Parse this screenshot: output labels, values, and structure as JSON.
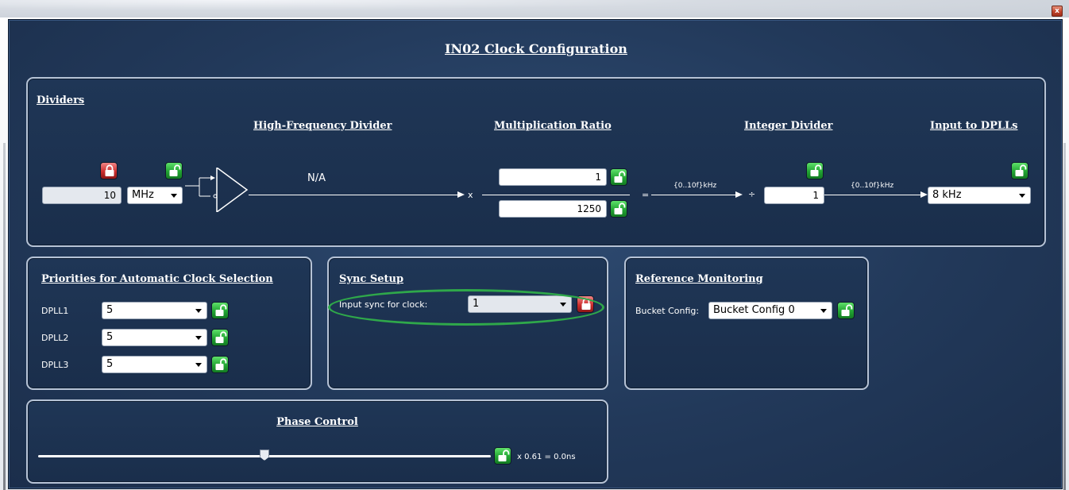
{
  "window": {
    "close_label": "x"
  },
  "title": "IN02 Clock Configuration",
  "dividers": {
    "title": "Dividers",
    "headers": {
      "hf_divider": "High-Frequency Divider",
      "mult_ratio": "Multiplication Ratio",
      "int_divider": "Integer Divider",
      "input_dplls": "Input to DPLLs"
    },
    "freq_value": "10",
    "freq_unit": "MHz",
    "hf_divider_value": "N/A",
    "mult_symbol": "x",
    "numerator": "1",
    "denominator": "1250",
    "equals_symbol": "=",
    "range_label_1": "{0..10f}kHz",
    "divide_symbol": "÷",
    "integer_divider_value": "1",
    "range_label_2": "{0..10f}kHz",
    "input_dplls_value": "8 kHz"
  },
  "priorities": {
    "title": "Priorities for Automatic Clock Selection",
    "rows": [
      {
        "label": "DPLL1",
        "value": "5"
      },
      {
        "label": "DPLL2",
        "value": "5"
      },
      {
        "label": "DPLL3",
        "value": "5"
      }
    ]
  },
  "sync_setup": {
    "title": "Sync Setup",
    "label": "Input sync for clock:",
    "value": "1"
  },
  "reference_monitoring": {
    "title": "Reference Monitoring",
    "label": "Bucket Config:",
    "value": "Bucket Config 0"
  },
  "phase_control": {
    "title": "Phase Control",
    "readout": "x 0.61 = 0.0ns",
    "slider_fraction": 0.5
  },
  "colors": {
    "background": "#22395a",
    "panel_border": "#b6c3d6",
    "lock_green": "#22a533",
    "lock_red": "#cc2e2e",
    "highlight": "#2fa84a"
  },
  "icons": {
    "unlocked": "unlocked-padlock-icon",
    "locked": "locked-padlock-icon"
  }
}
